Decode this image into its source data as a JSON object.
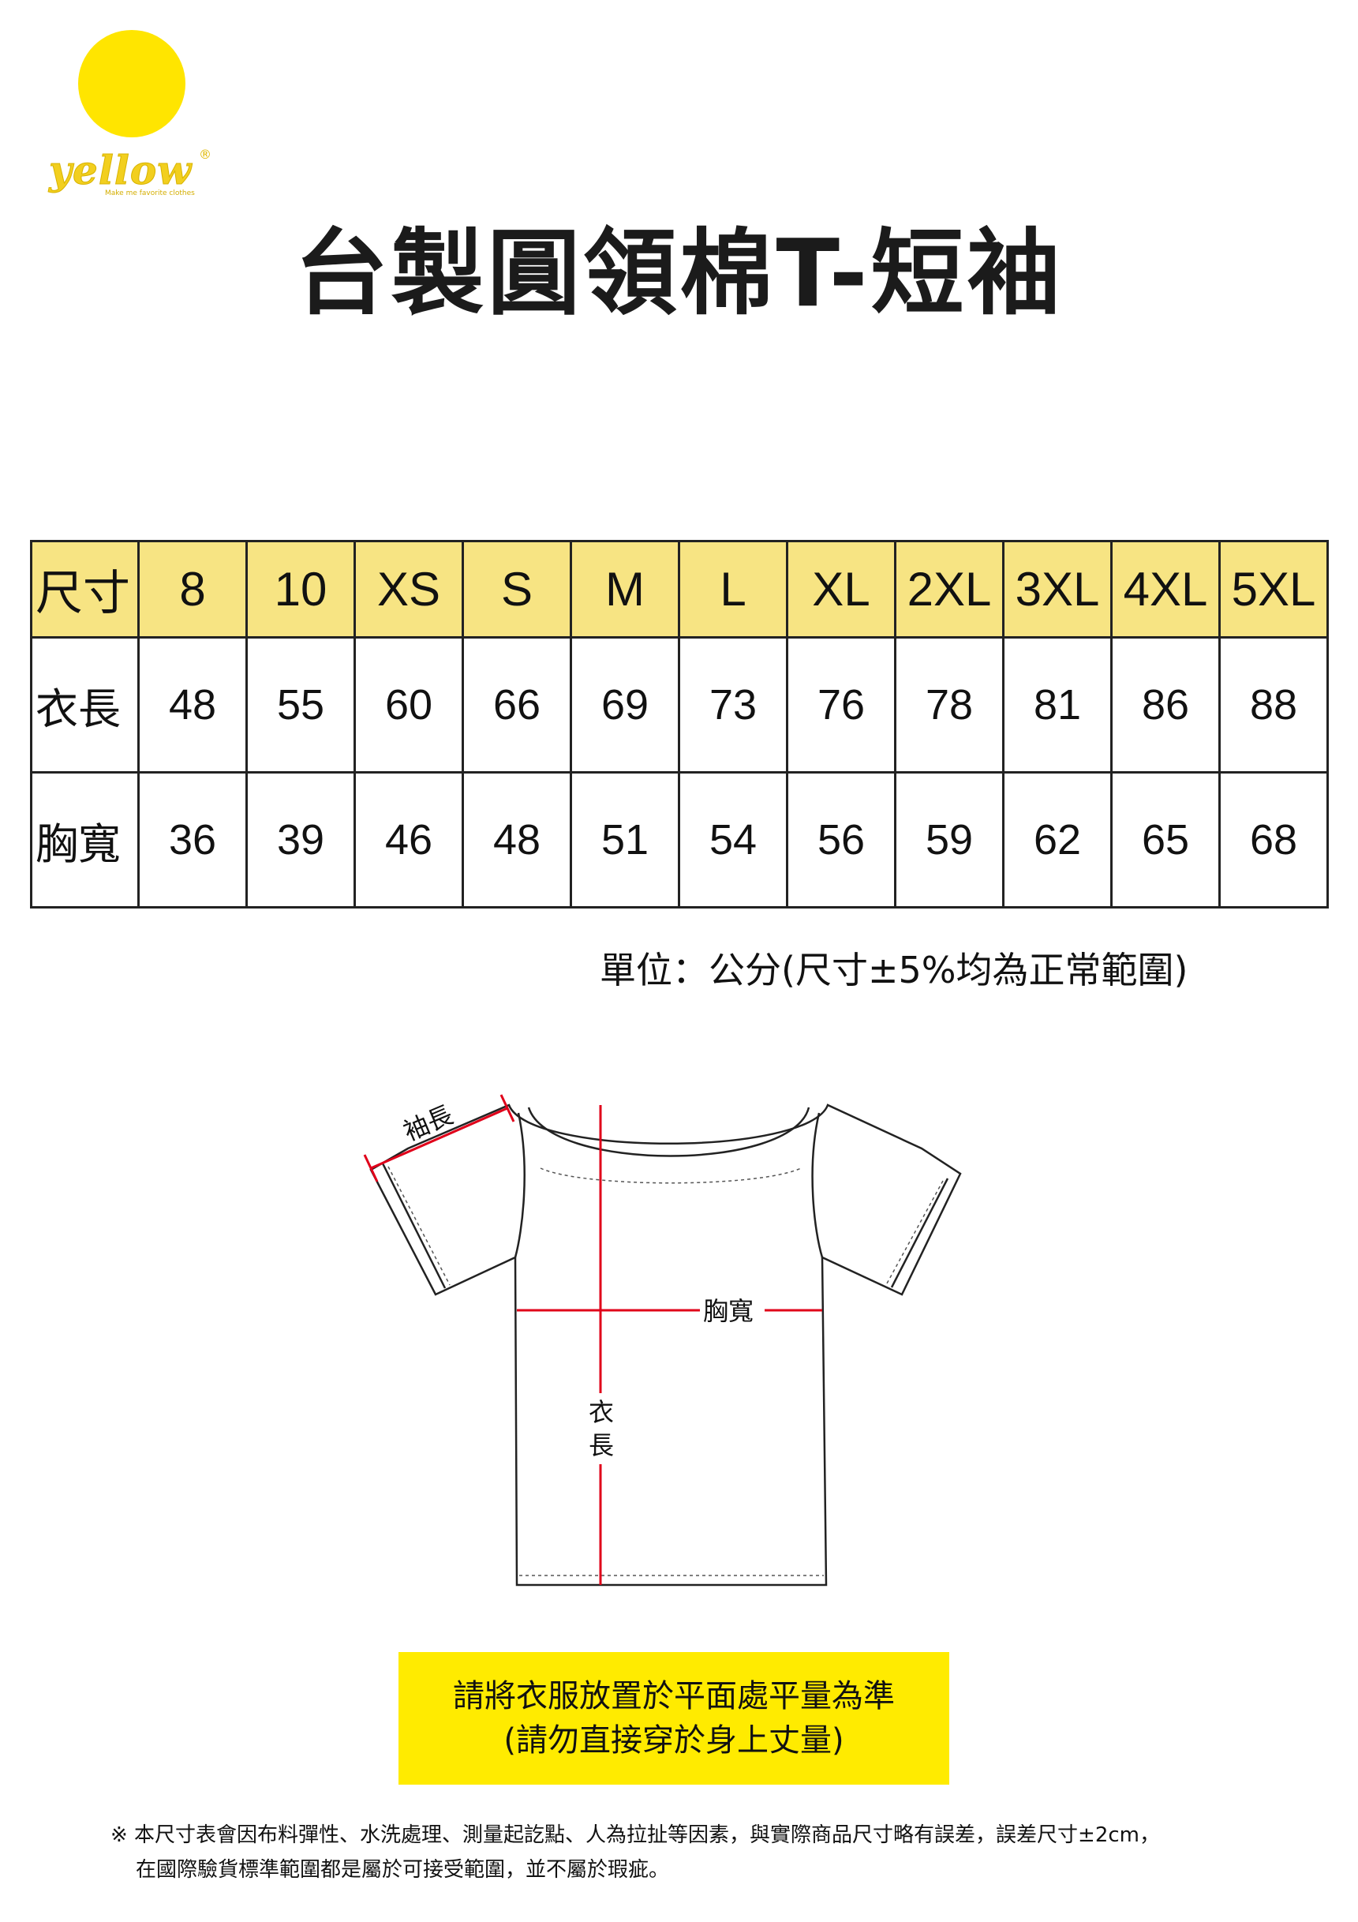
{
  "brand": {
    "name": "yellow",
    "registered_mark": "®",
    "tagline": "Make me favorite clothes",
    "circle_color": "#ffe500",
    "text_color": "#f2cf1f"
  },
  "title": "台製圓領棉T-短袖",
  "size_table": {
    "header": {
      "label": "尺寸",
      "sizes": [
        "8",
        "10",
        "XS",
        "S",
        "M",
        "L",
        "XL",
        "2XL",
        "3XL",
        "4XL",
        "5XL"
      ]
    },
    "rows": [
      {
        "label": "衣長",
        "values": [
          "48",
          "55",
          "60",
          "66",
          "69",
          "73",
          "76",
          "78",
          "81",
          "86",
          "88"
        ]
      },
      {
        "label": "胸寬",
        "values": [
          "36",
          "39",
          "46",
          "48",
          "51",
          "54",
          "56",
          "59",
          "62",
          "65",
          "68"
        ]
      }
    ],
    "header_color": "#f7e483"
  },
  "unit_note": "單位：公分(尺寸±5%均為正常範圍)",
  "diagram": {
    "sleeve_label": "袖長",
    "chest_label": "胸寬",
    "length_label_1": "衣",
    "length_label_2": "長",
    "measure_color": "#e0001a"
  },
  "notice": {
    "line1": "請將衣服放置於平面處平量為準",
    "line2": "(請勿直接穿於身上丈量)",
    "bg_color": "#ffeb00"
  },
  "footnote": {
    "line1": "※ 本尺寸表會因布料彈性、水洗處理、測量起訖點、人為拉扯等因素，與實際商品尺寸略有誤差，誤差尺寸±2cm，",
    "line2": "在國際驗貨標準範圍都是屬於可接受範圍，並不屬於瑕疵。"
  }
}
